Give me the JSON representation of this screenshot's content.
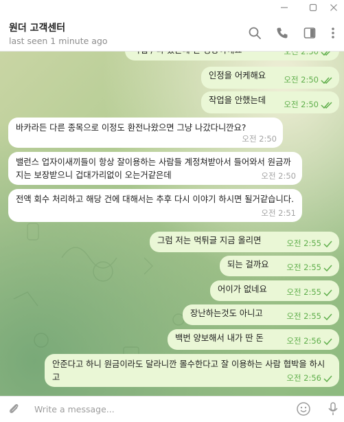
{
  "window": {
    "minimize_icon": "minimize-icon",
    "maximize_icon": "maximize-icon",
    "close_icon": "close-icon"
  },
  "header": {
    "title": "원더 고객센터",
    "status": "last seen 1 minute ago",
    "icons": [
      "search-icon",
      "phone-icon",
      "sidebar-toggle-icon",
      "more-vertical-icon"
    ]
  },
  "messages": [
    {
      "dir": "out",
      "text": "작업 / 다 했는데 간 정상이예요",
      "time": "오전 2:50",
      "read": true
    },
    {
      "dir": "out",
      "text": "인정을 어케해요",
      "time": "오전 2:50",
      "read": true
    },
    {
      "dir": "out",
      "text": "작업을 안했는데",
      "time": "오전 2:50",
      "read": true
    },
    {
      "dir": "in",
      "text": "바카라든 다른 종목으로 이정도 환전나왔으면 그냥 나갔다니깐요?",
      "time": "오전 2:50"
    },
    {
      "dir": "in",
      "text": "밸런스 업자이새끼들이 항상 잘이용하는 사람들 계정쳐받아서 들어와서 원금까지는 보장받으니 겁대가리없이 오는거같은데",
      "time": "오전 2:50"
    },
    {
      "dir": "in",
      "text": "전액 회수 처리하고 해당 건에 대해서는 추후 다시 이야기 하시면 될거같습니다.",
      "time": "오전 2:51"
    },
    {
      "dir": "out",
      "text": "그럼 저는 먹튀글 지금 올리면",
      "time": "오전 2:55",
      "read": false
    },
    {
      "dir": "out",
      "text": "되는 걸까요",
      "time": "오전 2:55",
      "read": false
    },
    {
      "dir": "out",
      "text": "어이가 없네요",
      "time": "오전 2:55",
      "read": false
    },
    {
      "dir": "out",
      "text": "장난하는것도 아니고",
      "time": "오전 2:55",
      "read": false
    },
    {
      "dir": "out",
      "text": "백번 양보해서 내가 딴 돈",
      "time": "오전 2:56",
      "read": false
    },
    {
      "dir": "out",
      "text": "안준다고 하니 원금이라도 달라니깐 몰수한다고 잘 이용하는 사람 협박을 하시고",
      "time": "오전 2:56",
      "read": false
    }
  ],
  "composer": {
    "placeholder": "Write a message...",
    "icons": [
      "attach-icon",
      "emoji-icon",
      "microphone-icon"
    ]
  }
}
